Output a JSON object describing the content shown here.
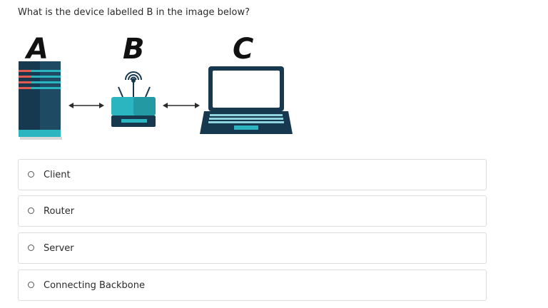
{
  "question": {
    "text": "What is the device labelled B in the image below?"
  },
  "figure": {
    "labels": [
      "A",
      "B",
      "C"
    ],
    "devices": [
      "server-icon",
      "router-icon",
      "laptop-icon"
    ],
    "colors": {
      "dark": "#17394f",
      "teal": "#2ab5c0",
      "red": "#e05a4f"
    }
  },
  "options": [
    {
      "label": "Client"
    },
    {
      "label": "Router"
    },
    {
      "label": "Server"
    },
    {
      "label": "Connecting Backbone"
    }
  ]
}
